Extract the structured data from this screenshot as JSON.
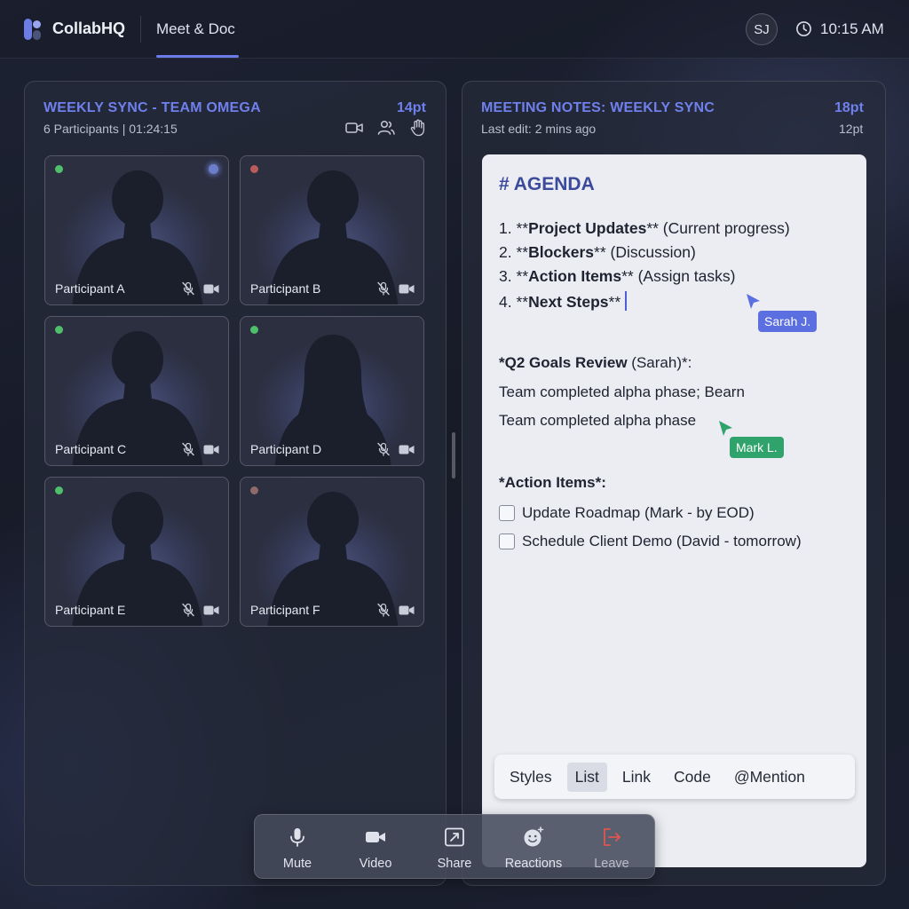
{
  "app": {
    "brand": "CollabHQ",
    "tab": "Meet & Doc"
  },
  "header": {
    "avatar_initials": "SJ",
    "time": "10:15 AM",
    "icons": [
      "clock-icon"
    ]
  },
  "meeting": {
    "title": "WEEKLY SYNC - TEAM OMEGA",
    "font_size": "14pt",
    "subtitle": "6 Participants | 01:24:15",
    "icons": [
      "video-icon",
      "participants-icon",
      "raise-hand-icon"
    ],
    "participants": [
      {
        "name": "Participant A",
        "status_color": "#4fbf6b",
        "speaking": true,
        "silhouette": "male"
      },
      {
        "name": "Participant B",
        "status_color": "#b85b5b",
        "speaking": false,
        "silhouette": "male"
      },
      {
        "name": "Participant C",
        "status_color": "#4fbf6b",
        "speaking": false,
        "silhouette": "male"
      },
      {
        "name": "Participant D",
        "status_color": "#4fbf6b",
        "speaking": false,
        "silhouette": "female"
      },
      {
        "name": "Participant E",
        "status_color": "#4fbf6b",
        "speaking": false,
        "silhouette": "male"
      },
      {
        "name": "Participant F",
        "status_color": "#8e6a6a",
        "speaking": false,
        "silhouette": "male"
      }
    ]
  },
  "notes": {
    "title": "MEETING NOTES: WEEKLY SYNC",
    "font_size": "18pt",
    "last_edit": "Last edit: 2 mins ago",
    "body_size": "12pt",
    "heading": "# AGENDA",
    "agenda": [
      {
        "num": "1. **",
        "bold": "Project Updates",
        "rest": "** (Current progress)"
      },
      {
        "num": "2. **",
        "bold": "Blockers",
        "rest": "** (Discussion)"
      },
      {
        "num": "3. **",
        "bold": "Action Items",
        "rest": "** (Assign tasks)"
      },
      {
        "num": "4. **",
        "bold": "Next Steps",
        "rest": "**"
      }
    ],
    "goals_heading_bold": "*Q2 Goals Review",
    "goals_heading_rest": " (Sarah)*:",
    "goals_line1": "Team completed alpha phase; Bearn",
    "goals_line2": "Team completed alpha phase",
    "action_heading": "*Action Items*:",
    "tasks": [
      {
        "label": "Update Roadmap (Mark - by EOD)",
        "checked": false
      },
      {
        "label": "Schedule Client Demo (David - tomorrow)",
        "checked": false
      }
    ],
    "cursors": [
      {
        "name": "Sarah J.",
        "color": "#5b6fe0"
      },
      {
        "name": "Mark L.",
        "color": "#2fa36b"
      }
    ]
  },
  "format_toolbar": {
    "buttons": [
      "Styles",
      "List",
      "Link",
      "Code",
      "@Mention"
    ],
    "active": "List"
  },
  "controls": [
    {
      "label": "Mute",
      "icon": "microphone-icon"
    },
    {
      "label": "Video",
      "icon": "camera-icon"
    },
    {
      "label": "Share",
      "icon": "share-screen-icon"
    },
    {
      "label": "Reactions",
      "icon": "emoji-icon"
    },
    {
      "label": "Leave",
      "icon": "leave-icon",
      "color": "#e0554f"
    }
  ]
}
